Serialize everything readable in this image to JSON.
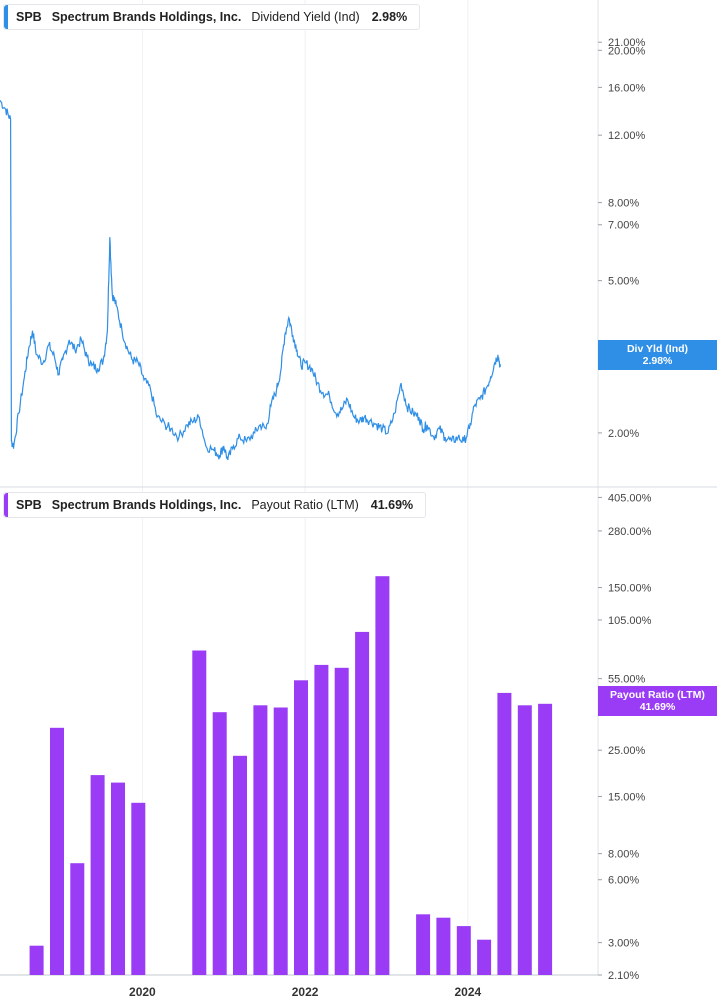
{
  "panels": [
    {
      "ticker": "SPB",
      "company": "Spectrum Brands Holdings, Inc.",
      "metric": "Dividend Yield (Ind)",
      "value": "2.98%",
      "badge_label": "Div Yld (Ind)",
      "badge_value": "2.98%",
      "color": "#2f8fe6"
    },
    {
      "ticker": "SPB",
      "company": "Spectrum Brands Holdings, Inc.",
      "metric": "Payout Ratio (LTM)",
      "value": "41.69%",
      "badge_label": "Payout Ratio (LTM)",
      "badge_value": "41.69%",
      "color": "#9a3cf5"
    }
  ],
  "chart_data": [
    {
      "type": "line",
      "series_name": "Dividend Yield (Ind)",
      "scale": "log",
      "ylim": [
        1.6,
        24
      ],
      "xlim": [
        2018.25,
        2025.6
      ],
      "y_ticks": [
        {
          "v": 21,
          "label": "21.00%"
        },
        {
          "v": 20,
          "label": "20.00%"
        },
        {
          "v": 16,
          "label": "16.00%"
        },
        {
          "v": 12,
          "label": "12.00%"
        },
        {
          "v": 8,
          "label": "8.00%"
        },
        {
          "v": 7,
          "label": "7.00%"
        },
        {
          "v": 5,
          "label": "5.00%"
        },
        {
          "v": 2,
          "label": "2.00%"
        }
      ],
      "points": [
        [
          2018.25,
          14.8
        ],
        [
          2018.32,
          14.0
        ],
        [
          2018.38,
          13.2
        ],
        [
          2018.39,
          1.9
        ],
        [
          2018.42,
          1.85
        ],
        [
          2018.48,
          2.25
        ],
        [
          2018.55,
          2.8
        ],
        [
          2018.6,
          3.3
        ],
        [
          2018.65,
          3.7
        ],
        [
          2018.7,
          3.2
        ],
        [
          2018.78,
          3.05
        ],
        [
          2018.85,
          3.4
        ],
        [
          2018.92,
          3.15
        ],
        [
          2018.97,
          2.85
        ],
        [
          2019.02,
          3.1
        ],
        [
          2019.1,
          3.5
        ],
        [
          2019.17,
          3.3
        ],
        [
          2019.25,
          3.5
        ],
        [
          2019.32,
          3.15
        ],
        [
          2019.38,
          3.0
        ],
        [
          2019.45,
          2.95
        ],
        [
          2019.52,
          3.1
        ],
        [
          2019.57,
          3.7
        ],
        [
          2019.6,
          6.5
        ],
        [
          2019.63,
          4.6
        ],
        [
          2019.68,
          4.3
        ],
        [
          2019.75,
          3.7
        ],
        [
          2019.82,
          3.3
        ],
        [
          2019.88,
          3.1
        ],
        [
          2019.95,
          3.05
        ],
        [
          2020.02,
          2.75
        ],
        [
          2020.1,
          2.6
        ],
        [
          2020.18,
          2.2
        ],
        [
          2020.28,
          2.1
        ],
        [
          2020.35,
          2.05
        ],
        [
          2020.45,
          1.95
        ],
        [
          2020.55,
          2.1
        ],
        [
          2020.63,
          2.15
        ],
        [
          2020.7,
          2.2
        ],
        [
          2020.78,
          1.85
        ],
        [
          2020.88,
          1.8
        ],
        [
          2020.95,
          1.75
        ],
        [
          2021.0,
          1.85
        ],
        [
          2021.05,
          1.7
        ],
        [
          2021.12,
          1.85
        ],
        [
          2021.2,
          1.95
        ],
        [
          2021.28,
          1.9
        ],
        [
          2021.38,
          2.0
        ],
        [
          2021.45,
          2.1
        ],
        [
          2021.52,
          2.05
        ],
        [
          2021.58,
          2.35
        ],
        [
          2021.65,
          2.6
        ],
        [
          2021.7,
          2.9
        ],
        [
          2021.75,
          3.6
        ],
        [
          2021.8,
          4.0
        ],
        [
          2021.85,
          3.6
        ],
        [
          2021.9,
          3.3
        ],
        [
          2021.95,
          3.0
        ],
        [
          2022.0,
          3.05
        ],
        [
          2022.08,
          2.95
        ],
        [
          2022.15,
          2.7
        ],
        [
          2022.22,
          2.55
        ],
        [
          2022.3,
          2.5
        ],
        [
          2022.38,
          2.25
        ],
        [
          2022.45,
          2.3
        ],
        [
          2022.52,
          2.45
        ],
        [
          2022.6,
          2.2
        ],
        [
          2022.67,
          2.15
        ],
        [
          2022.73,
          2.2
        ],
        [
          2022.8,
          2.15
        ],
        [
          2022.88,
          2.1
        ],
        [
          2022.95,
          2.05
        ],
        [
          2023.02,
          2.0
        ],
        [
          2023.1,
          2.25
        ],
        [
          2023.18,
          2.7
        ],
        [
          2023.25,
          2.35
        ],
        [
          2023.33,
          2.25
        ],
        [
          2023.4,
          2.2
        ],
        [
          2023.45,
          2.05
        ],
        [
          2023.5,
          2.1
        ],
        [
          2023.58,
          1.95
        ],
        [
          2023.65,
          2.05
        ],
        [
          2023.72,
          1.95
        ],
        [
          2023.8,
          1.9
        ],
        [
          2023.88,
          1.95
        ],
        [
          2023.95,
          1.9
        ],
        [
          2024.02,
          2.05
        ],
        [
          2024.08,
          2.35
        ],
        [
          2024.15,
          2.45
        ],
        [
          2024.22,
          2.6
        ],
        [
          2024.28,
          2.8
        ],
        [
          2024.33,
          3.05
        ],
        [
          2024.37,
          3.2
        ],
        [
          2024.4,
          2.98
        ]
      ]
    },
    {
      "type": "bar",
      "series_name": "Payout Ratio (LTM)",
      "scale": "log",
      "ylim": [
        2.1,
        430
      ],
      "y_ticks": [
        {
          "v": 405,
          "label": "405.00%"
        },
        {
          "v": 280,
          "label": "280.00%"
        },
        {
          "v": 150,
          "label": "150.00%"
        },
        {
          "v": 105,
          "label": "105.00%"
        },
        {
          "v": 55,
          "label": "55.00%"
        },
        {
          "v": 25,
          "label": "25.00%"
        },
        {
          "v": 15,
          "label": "15.00%"
        },
        {
          "v": 8,
          "label": "8.00%"
        },
        {
          "v": 6,
          "label": "6.00%"
        },
        {
          "v": 3,
          "label": "3.00%"
        },
        {
          "v": 2.1,
          "label": "2.10%"
        }
      ],
      "bars": [
        {
          "x": 2018.7,
          "v": 2.9
        },
        {
          "x": 2018.95,
          "v": 32
        },
        {
          "x": 2019.2,
          "v": 7.2
        },
        {
          "x": 2019.45,
          "v": 19
        },
        {
          "x": 2019.7,
          "v": 17.5
        },
        {
          "x": 2019.95,
          "v": 14
        },
        {
          "x": 2020.7,
          "v": 75
        },
        {
          "x": 2020.95,
          "v": 38
        },
        {
          "x": 2021.2,
          "v": 23.5
        },
        {
          "x": 2021.45,
          "v": 41
        },
        {
          "x": 2021.7,
          "v": 40
        },
        {
          "x": 2021.95,
          "v": 54
        },
        {
          "x": 2022.2,
          "v": 64
        },
        {
          "x": 2022.45,
          "v": 62
        },
        {
          "x": 2022.7,
          "v": 92
        },
        {
          "x": 2022.95,
          "v": 170
        },
        {
          "x": 2023.45,
          "v": 4.1
        },
        {
          "x": 2023.7,
          "v": 3.95
        },
        {
          "x": 2023.95,
          "v": 3.6
        },
        {
          "x": 2024.2,
          "v": 3.1
        },
        {
          "x": 2024.45,
          "v": 47
        },
        {
          "x": 2024.7,
          "v": 41
        },
        {
          "x": 2024.95,
          "v": 41.69
        }
      ],
      "x_ticks": [
        {
          "x": 2020,
          "label": "2020"
        },
        {
          "x": 2022,
          "label": "2022"
        },
        {
          "x": 2024,
          "label": "2024"
        }
      ]
    }
  ]
}
